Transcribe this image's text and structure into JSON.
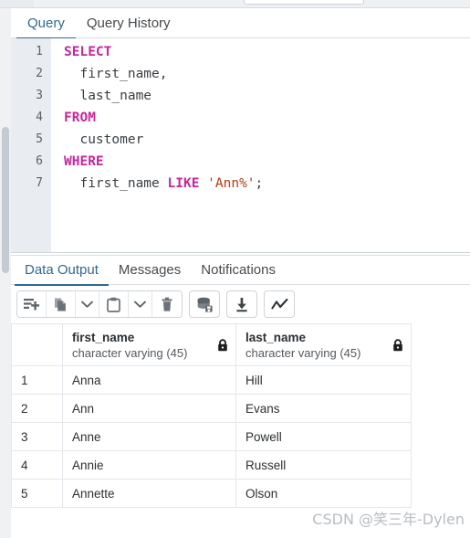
{
  "query_tabs": [
    {
      "label": "Query",
      "active": true
    },
    {
      "label": "Query History",
      "active": false
    }
  ],
  "editor": {
    "line_numbers": [
      "1",
      "2",
      "3",
      "4",
      "5",
      "6",
      "7"
    ],
    "lines": [
      {
        "tokens": [
          {
            "t": "SELECT",
            "k": "kw"
          }
        ]
      },
      {
        "tokens": [
          {
            "t": "  first_name,",
            "k": "pl"
          }
        ]
      },
      {
        "tokens": [
          {
            "t": "  last_name",
            "k": "pl"
          }
        ]
      },
      {
        "tokens": [
          {
            "t": "FROM",
            "k": "kw"
          }
        ]
      },
      {
        "tokens": [
          {
            "t": "  customer",
            "k": "pl"
          }
        ]
      },
      {
        "tokens": [
          {
            "t": "WHERE",
            "k": "kw"
          }
        ]
      },
      {
        "tokens": [
          {
            "t": "  first_name ",
            "k": "pl"
          },
          {
            "t": "LIKE",
            "k": "kw"
          },
          {
            "t": " ",
            "k": "pl"
          },
          {
            "t": "'Ann%'",
            "k": "str"
          },
          {
            "t": ";",
            "k": "pl"
          }
        ]
      }
    ],
    "full_text": "SELECT\n  first_name,\n  last_name\nFROM\n  customer\nWHERE\n  first_name LIKE 'Ann%';"
  },
  "output_tabs": [
    {
      "label": "Data Output",
      "active": true
    },
    {
      "label": "Messages",
      "active": false
    },
    {
      "label": "Notifications",
      "active": false
    }
  ],
  "toolbar": {
    "buttons": [
      {
        "name": "add-row-icon",
        "title": "Add row"
      },
      {
        "name": "copy-icon",
        "title": "Copy"
      },
      {
        "name": "chevron-down-icon",
        "title": "Copy options"
      },
      {
        "name": "paste-icon",
        "title": "Paste"
      },
      {
        "name": "chevron-down-icon",
        "title": "Paste options"
      },
      {
        "name": "trash-icon",
        "title": "Delete row"
      },
      {
        "name": "save-data-changes-icon",
        "title": "Save data changes"
      },
      {
        "name": "download-icon",
        "title": "Download as CSV"
      },
      {
        "name": "graph-visualiser-icon",
        "title": "Graph visualiser"
      }
    ]
  },
  "result_grid": {
    "index_header": "",
    "columns": [
      {
        "name": "first_name",
        "type": "character varying (45)",
        "locked": true
      },
      {
        "name": "last_name",
        "type": "character varying (45)",
        "locked": true
      }
    ],
    "rows": [
      {
        "index": "1",
        "first_name": "Anna",
        "last_name": "Hill"
      },
      {
        "index": "2",
        "first_name": "Ann",
        "last_name": "Evans"
      },
      {
        "index": "3",
        "first_name": "Anne",
        "last_name": "Powell"
      },
      {
        "index": "4",
        "first_name": "Annie",
        "last_name": "Russell"
      },
      {
        "index": "5",
        "first_name": "Annette",
        "last_name": "Olson"
      }
    ]
  },
  "watermark": {
    "text": "CSDN @笑三年-Dylen"
  },
  "colors": {
    "accent_blue": "#31688f",
    "keyword_magenta": "#c2299a",
    "string_rust": "#b23c17",
    "gutter_bg": "#e9edf1",
    "border_grey": "#e3e6ea",
    "watermark_grey": "#b9bdc2"
  }
}
